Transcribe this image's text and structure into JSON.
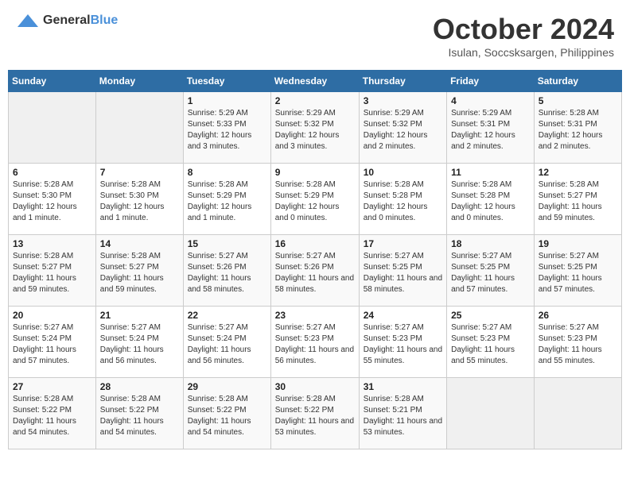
{
  "header": {
    "logo_general": "General",
    "logo_blue": "Blue",
    "month": "October 2024",
    "location": "Isulan, Soccsksargen, Philippines"
  },
  "weekdays": [
    "Sunday",
    "Monday",
    "Tuesday",
    "Wednesday",
    "Thursday",
    "Friday",
    "Saturday"
  ],
  "weeks": [
    [
      {
        "day": "",
        "info": ""
      },
      {
        "day": "",
        "info": ""
      },
      {
        "day": "1",
        "info": "Sunrise: 5:29 AM\nSunset: 5:33 PM\nDaylight: 12 hours and 3 minutes."
      },
      {
        "day": "2",
        "info": "Sunrise: 5:29 AM\nSunset: 5:32 PM\nDaylight: 12 hours and 3 minutes."
      },
      {
        "day": "3",
        "info": "Sunrise: 5:29 AM\nSunset: 5:32 PM\nDaylight: 12 hours and 2 minutes."
      },
      {
        "day": "4",
        "info": "Sunrise: 5:29 AM\nSunset: 5:31 PM\nDaylight: 12 hours and 2 minutes."
      },
      {
        "day": "5",
        "info": "Sunrise: 5:28 AM\nSunset: 5:31 PM\nDaylight: 12 hours and 2 minutes."
      }
    ],
    [
      {
        "day": "6",
        "info": "Sunrise: 5:28 AM\nSunset: 5:30 PM\nDaylight: 12 hours and 1 minute."
      },
      {
        "day": "7",
        "info": "Sunrise: 5:28 AM\nSunset: 5:30 PM\nDaylight: 12 hours and 1 minute."
      },
      {
        "day": "8",
        "info": "Sunrise: 5:28 AM\nSunset: 5:29 PM\nDaylight: 12 hours and 1 minute."
      },
      {
        "day": "9",
        "info": "Sunrise: 5:28 AM\nSunset: 5:29 PM\nDaylight: 12 hours and 0 minutes."
      },
      {
        "day": "10",
        "info": "Sunrise: 5:28 AM\nSunset: 5:28 PM\nDaylight: 12 hours and 0 minutes."
      },
      {
        "day": "11",
        "info": "Sunrise: 5:28 AM\nSunset: 5:28 PM\nDaylight: 12 hours and 0 minutes."
      },
      {
        "day": "12",
        "info": "Sunrise: 5:28 AM\nSunset: 5:27 PM\nDaylight: 11 hours and 59 minutes."
      }
    ],
    [
      {
        "day": "13",
        "info": "Sunrise: 5:28 AM\nSunset: 5:27 PM\nDaylight: 11 hours and 59 minutes."
      },
      {
        "day": "14",
        "info": "Sunrise: 5:28 AM\nSunset: 5:27 PM\nDaylight: 11 hours and 59 minutes."
      },
      {
        "day": "15",
        "info": "Sunrise: 5:27 AM\nSunset: 5:26 PM\nDaylight: 11 hours and 58 minutes."
      },
      {
        "day": "16",
        "info": "Sunrise: 5:27 AM\nSunset: 5:26 PM\nDaylight: 11 hours and 58 minutes."
      },
      {
        "day": "17",
        "info": "Sunrise: 5:27 AM\nSunset: 5:25 PM\nDaylight: 11 hours and 58 minutes."
      },
      {
        "day": "18",
        "info": "Sunrise: 5:27 AM\nSunset: 5:25 PM\nDaylight: 11 hours and 57 minutes."
      },
      {
        "day": "19",
        "info": "Sunrise: 5:27 AM\nSunset: 5:25 PM\nDaylight: 11 hours and 57 minutes."
      }
    ],
    [
      {
        "day": "20",
        "info": "Sunrise: 5:27 AM\nSunset: 5:24 PM\nDaylight: 11 hours and 57 minutes."
      },
      {
        "day": "21",
        "info": "Sunrise: 5:27 AM\nSunset: 5:24 PM\nDaylight: 11 hours and 56 minutes."
      },
      {
        "day": "22",
        "info": "Sunrise: 5:27 AM\nSunset: 5:24 PM\nDaylight: 11 hours and 56 minutes."
      },
      {
        "day": "23",
        "info": "Sunrise: 5:27 AM\nSunset: 5:23 PM\nDaylight: 11 hours and 56 minutes."
      },
      {
        "day": "24",
        "info": "Sunrise: 5:27 AM\nSunset: 5:23 PM\nDaylight: 11 hours and 55 minutes."
      },
      {
        "day": "25",
        "info": "Sunrise: 5:27 AM\nSunset: 5:23 PM\nDaylight: 11 hours and 55 minutes."
      },
      {
        "day": "26",
        "info": "Sunrise: 5:27 AM\nSunset: 5:23 PM\nDaylight: 11 hours and 55 minutes."
      }
    ],
    [
      {
        "day": "27",
        "info": "Sunrise: 5:28 AM\nSunset: 5:22 PM\nDaylight: 11 hours and 54 minutes."
      },
      {
        "day": "28",
        "info": "Sunrise: 5:28 AM\nSunset: 5:22 PM\nDaylight: 11 hours and 54 minutes."
      },
      {
        "day": "29",
        "info": "Sunrise: 5:28 AM\nSunset: 5:22 PM\nDaylight: 11 hours and 54 minutes."
      },
      {
        "day": "30",
        "info": "Sunrise: 5:28 AM\nSunset: 5:22 PM\nDaylight: 11 hours and 53 minutes."
      },
      {
        "day": "31",
        "info": "Sunrise: 5:28 AM\nSunset: 5:21 PM\nDaylight: 11 hours and 53 minutes."
      },
      {
        "day": "",
        "info": ""
      },
      {
        "day": "",
        "info": ""
      }
    ]
  ]
}
